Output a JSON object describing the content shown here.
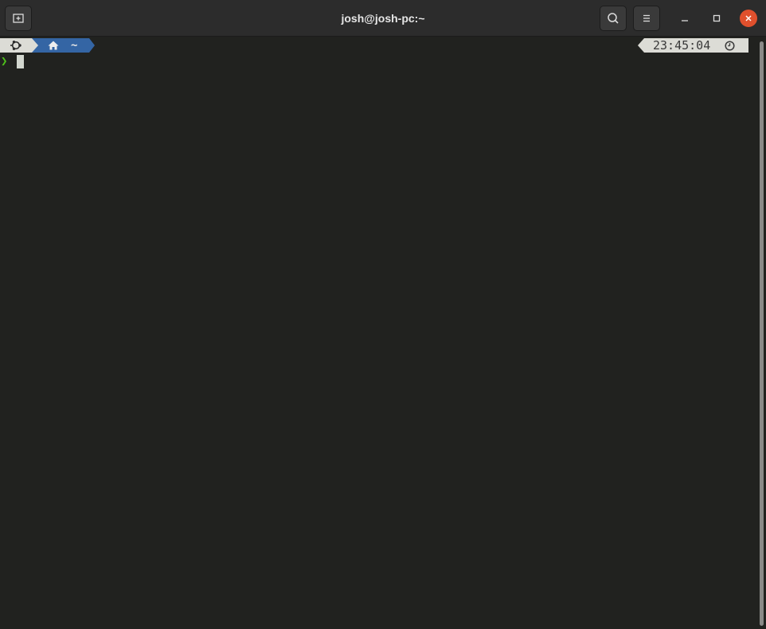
{
  "window": {
    "title": "josh@josh-pc:~"
  },
  "headerbar": {
    "new_tab_icon": "new-tab-icon",
    "search_icon": "search-icon",
    "menu_icon": "hamburger-menu-icon",
    "minimize_icon": "minimize-icon",
    "maximize_icon": "maximize-icon",
    "close_icon": "close-icon"
  },
  "prompt": {
    "os_icon": "ubuntu-icon",
    "dir_icon": "home-icon",
    "directory": "~",
    "prompt_symbol": "❯",
    "time": "23:45:04",
    "time_icon": "clock-icon"
  },
  "colors": {
    "terminal_bg": "#21221f",
    "headerbar_bg": "#2c2c2c",
    "segment_light": "#dcdcd6",
    "segment_dir": "#3465a4",
    "prompt_green": "#4ec21a",
    "close_button": "#e0502d"
  }
}
